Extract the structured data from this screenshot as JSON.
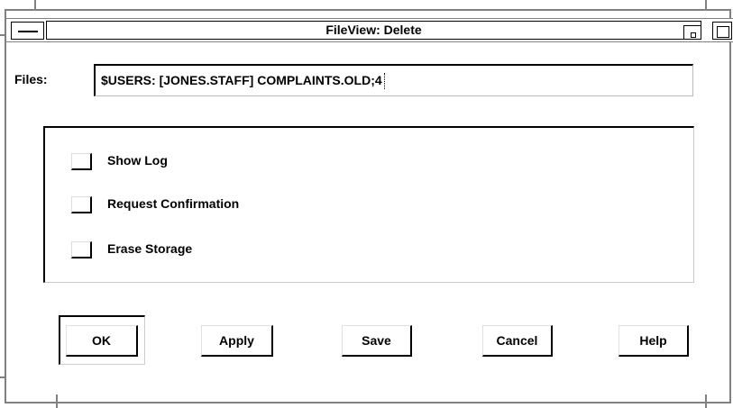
{
  "window": {
    "title": "FileView: Delete"
  },
  "files": {
    "label": "Files:",
    "value": "$USERS: [JONES.STAFF] COMPLAINTS.OLD;4"
  },
  "options": [
    {
      "label": "Show Log",
      "checked": false
    },
    {
      "label": "Request Confirmation",
      "checked": false
    },
    {
      "label": "Erase Storage",
      "checked": false
    }
  ],
  "buttons": {
    "ok": "OK",
    "apply": "Apply",
    "save": "Save",
    "cancel": "Cancel",
    "help": "Help"
  },
  "icons": {
    "window_menu": "window-menu-icon",
    "minimize": "minimize-icon",
    "maximize": "maximize-icon"
  }
}
